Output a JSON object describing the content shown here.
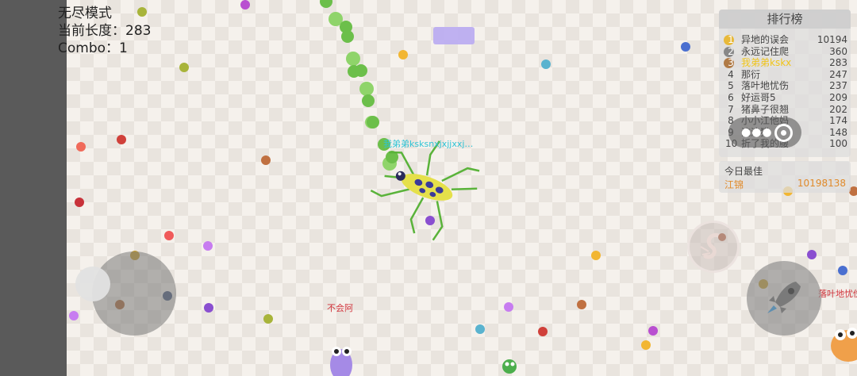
{
  "stats": {
    "mode": "无尽模式",
    "length_label": "当前长度：",
    "length_value": "283",
    "combo_label": "Combo：",
    "combo_value": "1"
  },
  "leaderboard": {
    "title": "排行榜",
    "rows": [
      {
        "rank": "1",
        "name": "异地的误会",
        "score": "10194"
      },
      {
        "rank": "2",
        "name": "永远记住爬",
        "score": "360"
      },
      {
        "rank": "3",
        "name": "我弟弟kskx",
        "score": "283"
      },
      {
        "rank": "4",
        "name": "那衍",
        "score": "247"
      },
      {
        "rank": "5",
        "name": "落叶地忧伤",
        "score": "237"
      },
      {
        "rank": "6",
        "name": "好运哥5",
        "score": "209"
      },
      {
        "rank": "7",
        "name": "猪鼻子很翘",
        "score": "202"
      },
      {
        "rank": "8",
        "name": "小小江他妈",
        "score": "174"
      },
      {
        "rank": "9",
        "name": "流浪猫",
        "score": "148"
      },
      {
        "rank": "10",
        "name": "折了我的腰",
        "score": "100"
      }
    ],
    "medal_colors": [
      "#e8b93a",
      "#888888",
      "#b07a45"
    ],
    "self_color": "#f0c419"
  },
  "today_best": {
    "title": "今日最佳",
    "name": "江锦",
    "score": "10198138"
  },
  "players": {
    "self_name": "我弟弟ksksnxjxjjxxj…",
    "enemy_name": "不会阿",
    "edge_name": "落叶地忧伤"
  },
  "icons": {
    "boost": "rocket-icon",
    "skill": "snake-swirl-icon",
    "menu": "more-dots-icon",
    "close": "target-circle-icon"
  }
}
